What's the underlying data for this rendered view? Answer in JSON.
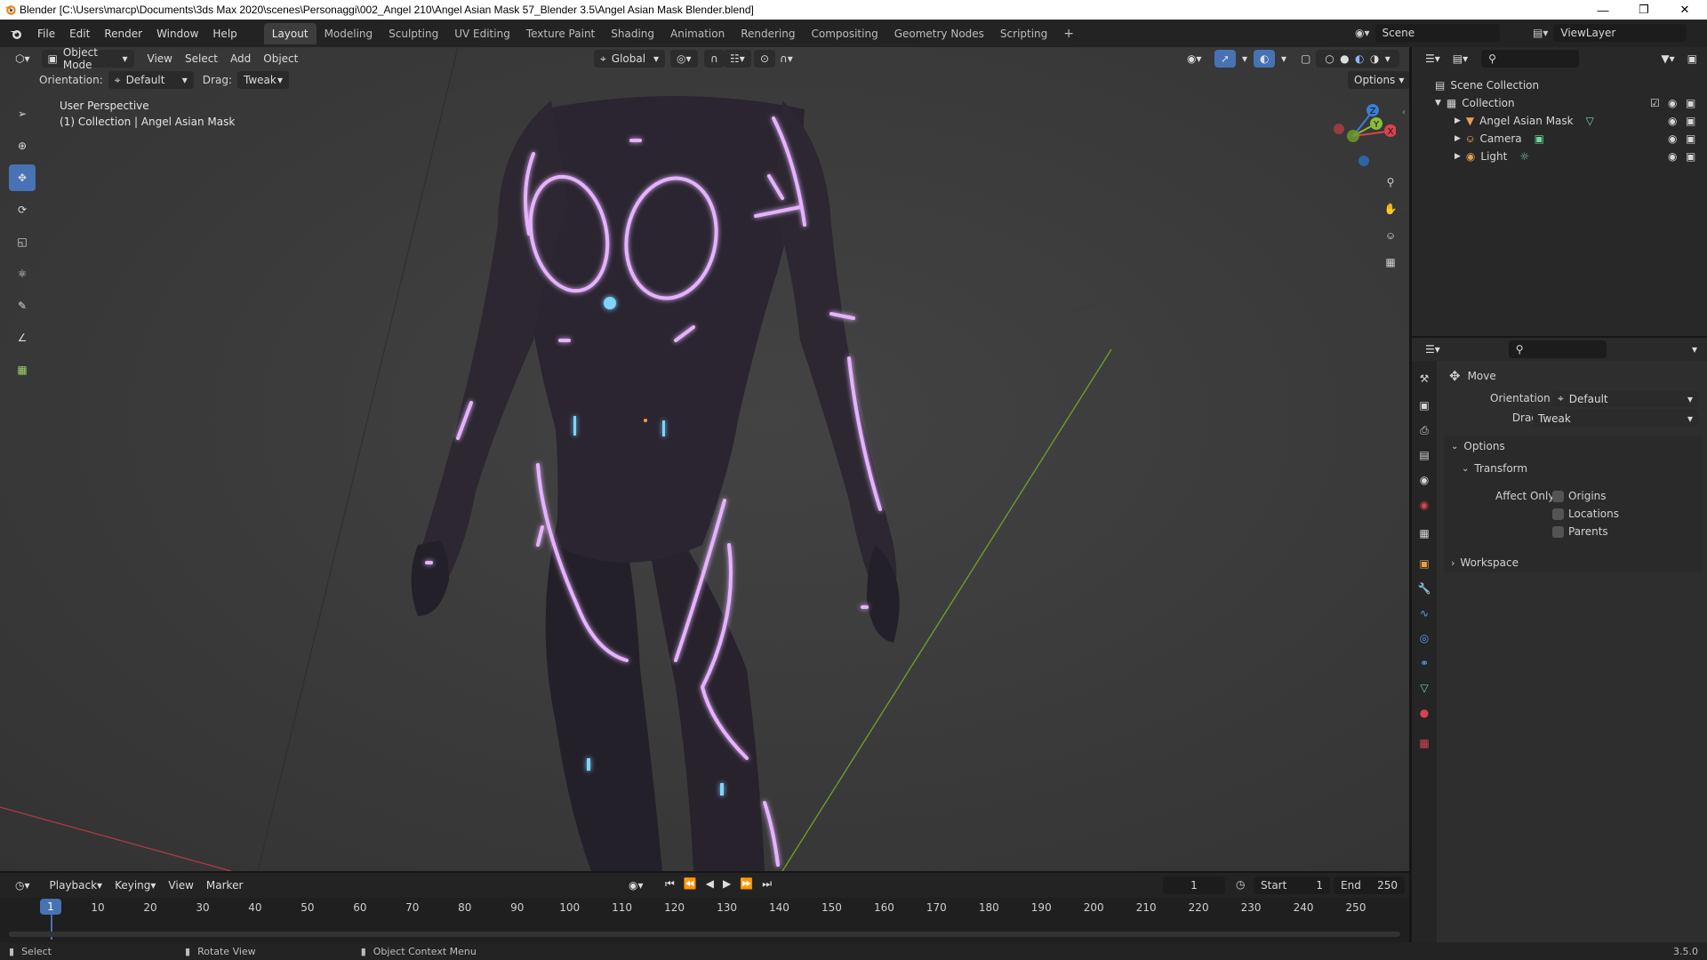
{
  "title": "Blender [C:\\Users\\marcp\\Documents\\3ds Max 2020\\scenes\\Personaggi\\002_Angel 210\\Angel Asian Mask 57_Blender 3.5\\Angel Asian Mask Blender.blend]",
  "menus": [
    "File",
    "Edit",
    "Render",
    "Window",
    "Help"
  ],
  "workspaces": [
    "Layout",
    "Modeling",
    "Sculpting",
    "UV Editing",
    "Texture Paint",
    "Shading",
    "Animation",
    "Rendering",
    "Compositing",
    "Geometry Nodes",
    "Scripting"
  ],
  "active_workspace": "Layout",
  "scene": "Scene",
  "view_layer": "ViewLayer",
  "viewport": {
    "mode": "Object Mode",
    "header_menus": [
      "View",
      "Select",
      "Add",
      "Object"
    ],
    "transform_orientation": "Global",
    "orientation_label": "Orientation:",
    "orientation_value": "Default",
    "drag_label": "Drag:",
    "drag_value": "Tweak",
    "options_label": "Options",
    "info_line1": "User Perspective",
    "info_line2": "(1) Collection | Angel Asian Mask",
    "gizmo_x": "X",
    "gizmo_y": "Y",
    "gizmo_z": "Z"
  },
  "outliner": {
    "root": "Scene Collection",
    "collection": "Collection",
    "items": [
      {
        "name": "Angel Asian Mask",
        "icon": "mesh-icon",
        "color": "#e8a04a"
      },
      {
        "name": "Camera",
        "icon": "camera-icon",
        "color": "#e8a04a"
      },
      {
        "name": "Light",
        "icon": "light-icon",
        "color": "#e8a04a"
      }
    ]
  },
  "properties": {
    "tool_title": "Move",
    "orientation_label": "Orientation",
    "orientation_value": "Default",
    "drag_label": "Drag:",
    "drag_value": "Tweak",
    "options_label": "Options",
    "transform_label": "Transform",
    "affect_only_label": "Affect Only",
    "checkboxes": [
      "Origins",
      "Locations",
      "Parents"
    ],
    "workspace_label": "Workspace"
  },
  "timeline": {
    "menus": [
      "Playback",
      "Keying",
      "View",
      "Marker"
    ],
    "current_frame": "1",
    "start_label": "Start",
    "start_value": "1",
    "end_label": "End",
    "end_value": "250",
    "ticks": [
      "1",
      "10",
      "20",
      "30",
      "40",
      "50",
      "60",
      "70",
      "80",
      "90",
      "100",
      "110",
      "120",
      "130",
      "140",
      "150",
      "160",
      "170",
      "180",
      "190",
      "200",
      "210",
      "220",
      "230",
      "240",
      "250"
    ]
  },
  "status": {
    "select": "Select",
    "rotate": "Rotate View",
    "context": "Object Context Menu",
    "version": "3.5.0"
  },
  "colors": {
    "accent": "#4772b3",
    "glow": "#e8a8ff",
    "x_axis": "#d9434e",
    "y_axis": "#8cba3a",
    "z_axis": "#3a7fd6"
  }
}
